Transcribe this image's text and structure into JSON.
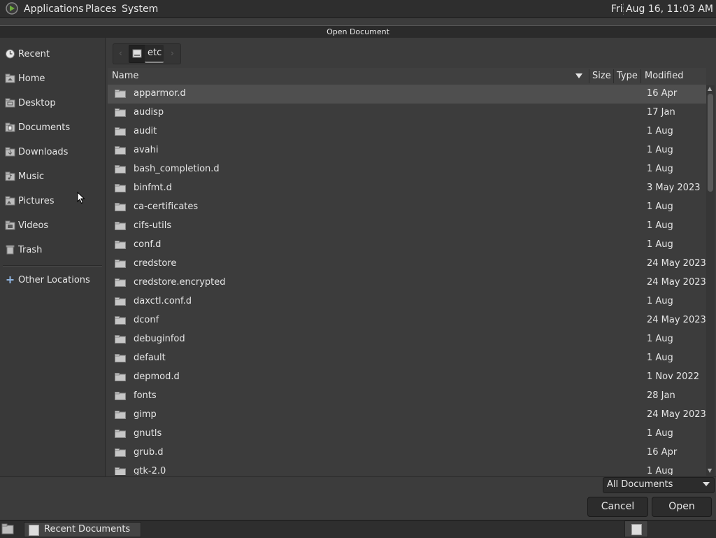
{
  "top_panel": {
    "menus": [
      "Applications",
      "Places",
      "System"
    ],
    "clock": "Fri Aug 16, 11:03 AM"
  },
  "window": {
    "title": "Open Document"
  },
  "sidebar": {
    "items": [
      {
        "label": "Recent",
        "icon": "clock-icon"
      },
      {
        "label": "Home",
        "icon": "home-folder-icon"
      },
      {
        "label": "Desktop",
        "icon": "folder-icon"
      },
      {
        "label": "Documents",
        "icon": "folder-icon"
      },
      {
        "label": "Downloads",
        "icon": "folder-icon"
      },
      {
        "label": "Music",
        "icon": "folder-icon"
      },
      {
        "label": "Pictures",
        "icon": "folder-icon"
      },
      {
        "label": "Videos",
        "icon": "folder-icon"
      },
      {
        "label": "Trash",
        "icon": "trash-icon"
      }
    ],
    "other": {
      "label": "Other Locations",
      "icon": "plus-icon"
    }
  },
  "pathbar": {
    "current": "etc"
  },
  "columns": {
    "name": "Name",
    "size": "Size",
    "type": "Type",
    "modified": "Modified"
  },
  "files": [
    {
      "name": "apparmor.d",
      "modified": "16 Apr"
    },
    {
      "name": "audisp",
      "modified": "17 Jan"
    },
    {
      "name": "audit",
      "modified": "1 Aug"
    },
    {
      "name": "avahi",
      "modified": "1 Aug"
    },
    {
      "name": "bash_completion.d",
      "modified": "1 Aug"
    },
    {
      "name": "binfmt.d",
      "modified": "3 May 2023"
    },
    {
      "name": "ca-certificates",
      "modified": "1 Aug"
    },
    {
      "name": "cifs-utils",
      "modified": "1 Aug"
    },
    {
      "name": "conf.d",
      "modified": "1 Aug"
    },
    {
      "name": "credstore",
      "modified": "24 May 2023"
    },
    {
      "name": "credstore.encrypted",
      "modified": "24 May 2023"
    },
    {
      "name": "daxctl.conf.d",
      "modified": "1 Aug"
    },
    {
      "name": "dconf",
      "modified": "24 May 2023"
    },
    {
      "name": "debuginfod",
      "modified": "1 Aug"
    },
    {
      "name": "default",
      "modified": "1 Aug"
    },
    {
      "name": "depmod.d",
      "modified": "1 Nov 2022"
    },
    {
      "name": "fonts",
      "modified": "28 Jan"
    },
    {
      "name": "gimp",
      "modified": "24 May 2023"
    },
    {
      "name": "gnutls",
      "modified": "1 Aug"
    },
    {
      "name": "grub.d",
      "modified": "16 Apr"
    },
    {
      "name": "gtk-2.0",
      "modified": "1 Aug"
    }
  ],
  "filter": {
    "selected": "All Documents"
  },
  "buttons": {
    "cancel": "Cancel",
    "open": "Open"
  },
  "taskbar": {
    "item": "Recent Documents"
  },
  "colors": {
    "selected_row": "#4f4f4f",
    "background": "#3c3c3c"
  }
}
